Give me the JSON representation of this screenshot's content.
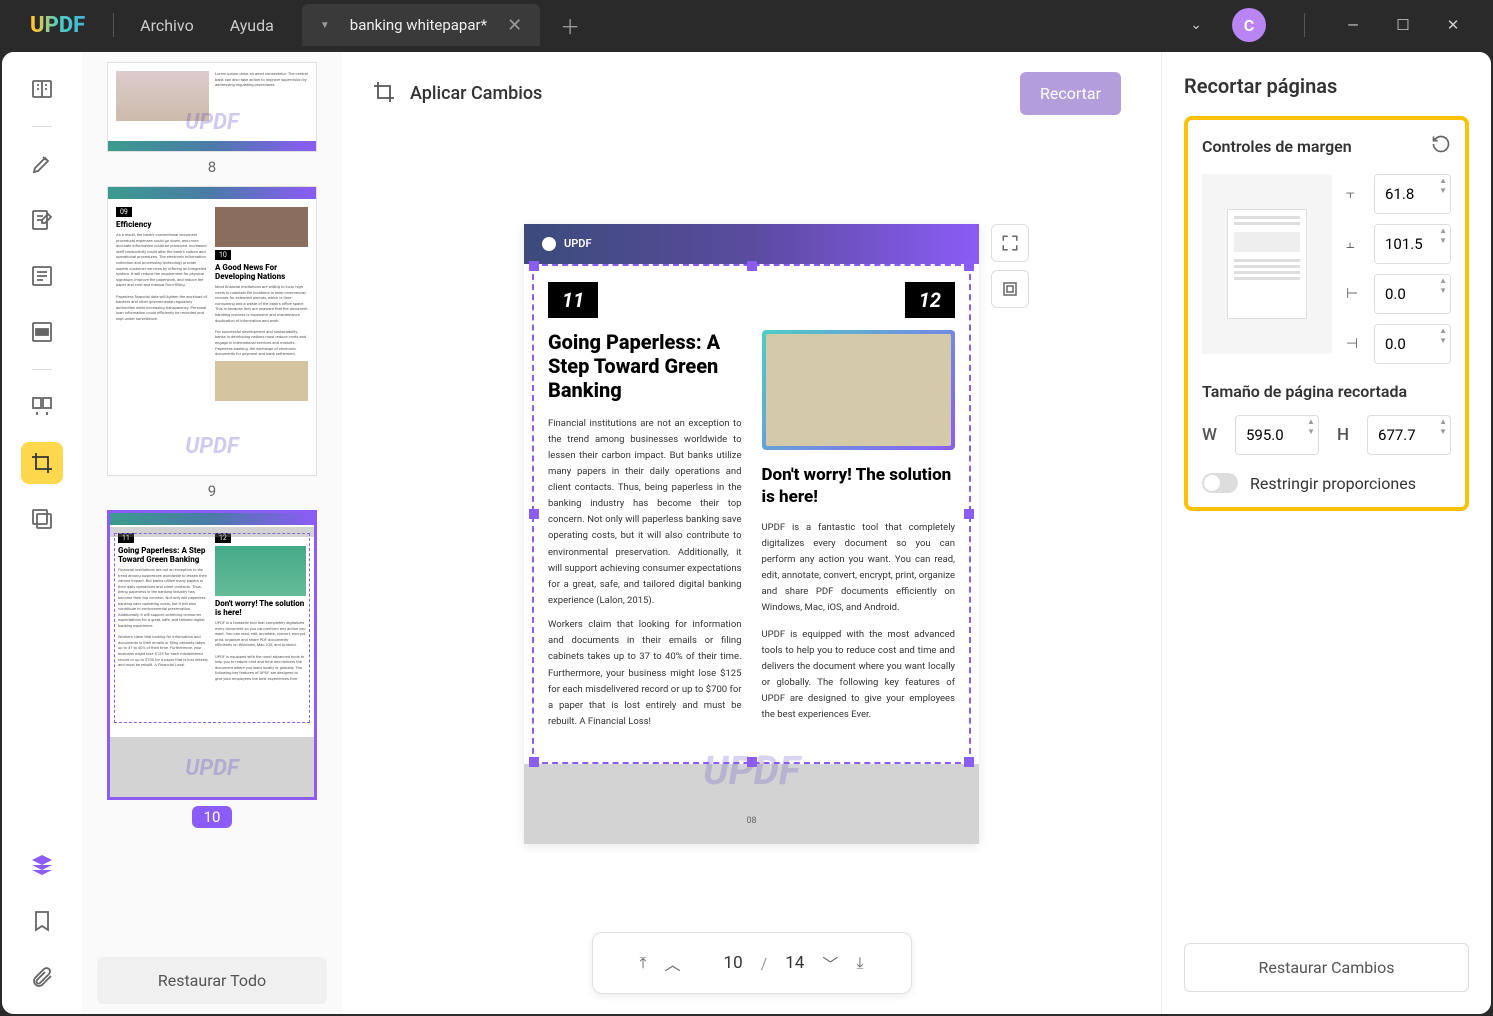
{
  "menu": {
    "archivo": "Archivo",
    "ayuda": "Ayuda"
  },
  "tab": {
    "title": "banking whitepapar*"
  },
  "avatar": "C",
  "thumbnails": {
    "n8": "8",
    "n9": "9",
    "n10": "10"
  },
  "restore_all": "Restaurar Todo",
  "main_header": "Aplicar Cambios",
  "crop_button": "Recortar",
  "page": {
    "logo": "UPDF",
    "num11": "11",
    "num12": "12",
    "title1": "Going Paperless: A Step Toward Green Banking",
    "text1a": "Financial institutions are not an exception to the trend among businesses worldwide to lessen their carbon impact. But banks utilize many papers in their daily operations and client contacts. Thus, being paperless in the banking industry has become their top concern. Not only will paperless banking save operating costs, but it will also contribute to environmental preservation. Additionally, it will support achieving consumer expectations for a great, safe, and tailored digital banking experience (Lalon, 2015).",
    "text1b": "Workers claim that looking for information and documents in their emails or filing cabinets takes up to 37 to 40% of their time. Furthermore, your business might lose $125 for each misdelivered record or up to $700 for a paper that is lost entirely and must be rebuilt. A Financial Loss!",
    "title2": "Don't worry! The solution  is here!",
    "text2a": "UPDF is a fantastic tool that completely digitalizes every document so you can perform any action you want. You can read, edit, annotate, convert, encrypt, print, organize and share PDF documents efficiently on Windows, Mac, iOS, and Android.",
    "text2b": "UPDF is equipped with the most advanced tools to help you to reduce cost and time and delivers the document where you want locally or globally. The following key features of UPDF are designed to give your employees the best experiences Ever.",
    "watermark": "UPDF",
    "pagenum": "08"
  },
  "pager": {
    "current": "10",
    "total": "14"
  },
  "right_panel": {
    "title": "Recortar páginas",
    "margin_controls": "Controles de margen",
    "top": "61.8",
    "bottom": "101.5",
    "left": "0.0",
    "right": "0.0",
    "size_title": "Tamaño de página recortada",
    "w_label": "W",
    "w": "595.0",
    "h_label": "H",
    "h": "677.7",
    "constrain": "Restringir proporciones",
    "restore": "Restaurar Cambios"
  },
  "thumb9": {
    "n09": "09",
    "t1": "Efficiency",
    "n10": "10",
    "t2": "A Good News For Developing Nations"
  },
  "thumb10": {
    "n11": "11",
    "t1": "Going Paperless: A Step Toward Green Banking",
    "n12": "12",
    "t2": "Don't worry! The solution is here!"
  }
}
